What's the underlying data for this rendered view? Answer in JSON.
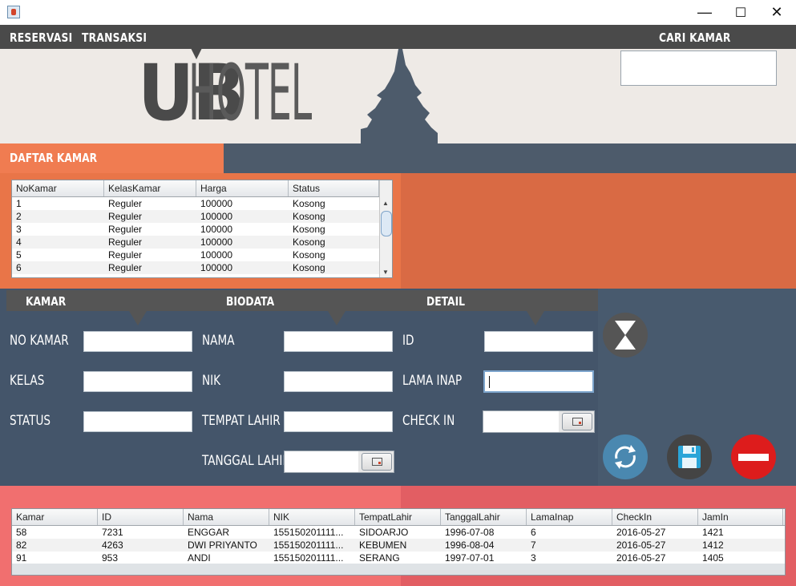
{
  "window": {
    "minimize": "—",
    "maximize": "☐",
    "close": "✕"
  },
  "nav": {
    "reservasi": "RESERVASI",
    "transaksi": "TRANSAKSI",
    "cari_kamar": "CARI KAMAR"
  },
  "search": {
    "value": ""
  },
  "logo": {
    "bold": "UB",
    "thin": "HOTEL"
  },
  "daftar_kamar": {
    "title": "DAFTAR KAMAR",
    "columns": [
      "NoKamar",
      "KelasKamar",
      "Harga",
      "Status"
    ],
    "rows": [
      [
        "1",
        "Reguler",
        "100000",
        "Kosong"
      ],
      [
        "2",
        "Reguler",
        "100000",
        "Kosong"
      ],
      [
        "3",
        "Reguler",
        "100000",
        "Kosong"
      ],
      [
        "4",
        "Reguler",
        "100000",
        "Kosong"
      ],
      [
        "5",
        "Reguler",
        "100000",
        "Kosong"
      ],
      [
        "6",
        "Reguler",
        "100000",
        "Kosong"
      ]
    ]
  },
  "sections": {
    "kamar": "KAMAR",
    "biodata": "BIODATA",
    "detail": "DETAIL"
  },
  "kamar": {
    "no_kamar": "NO KAMAR",
    "kelas": "KELAS",
    "status": "STATUS"
  },
  "biodata": {
    "nama": "NAMA",
    "nik": "NIK",
    "tempat_lahir": "TEMPAT LAHIR",
    "tanggal_lahir": "TANGGAL LAHIR"
  },
  "detail": {
    "id": "ID",
    "lama_inap": "LAMA INAP",
    "check_in": "CHECK IN"
  },
  "transactions": {
    "columns": [
      "Kamar",
      "ID",
      "Nama",
      "NIK",
      "TempatLahir",
      "TanggalLahir",
      "LamaInap",
      "CheckIn",
      "JamIn"
    ],
    "rows": [
      [
        "58",
        "7231",
        "ENGGAR",
        "155150201111...",
        "SIDOARJO",
        "1996-07-08",
        "6",
        "2016-05-27",
        "1421"
      ],
      [
        "82",
        "4263",
        "DWI PRIYANTO",
        "155150201111...",
        "KEBUMEN",
        "1996-08-04",
        "7",
        "2016-05-27",
        "1412"
      ],
      [
        "91",
        "953",
        "ANDI",
        "155150201111...",
        "SERANG",
        "1997-07-01",
        "3",
        "2016-05-27",
        "1405"
      ]
    ]
  },
  "colors": {
    "orange": "#e97548",
    "slate": "#44556a",
    "salmon": "#f16f6f",
    "dark": "#4a4a4a"
  }
}
